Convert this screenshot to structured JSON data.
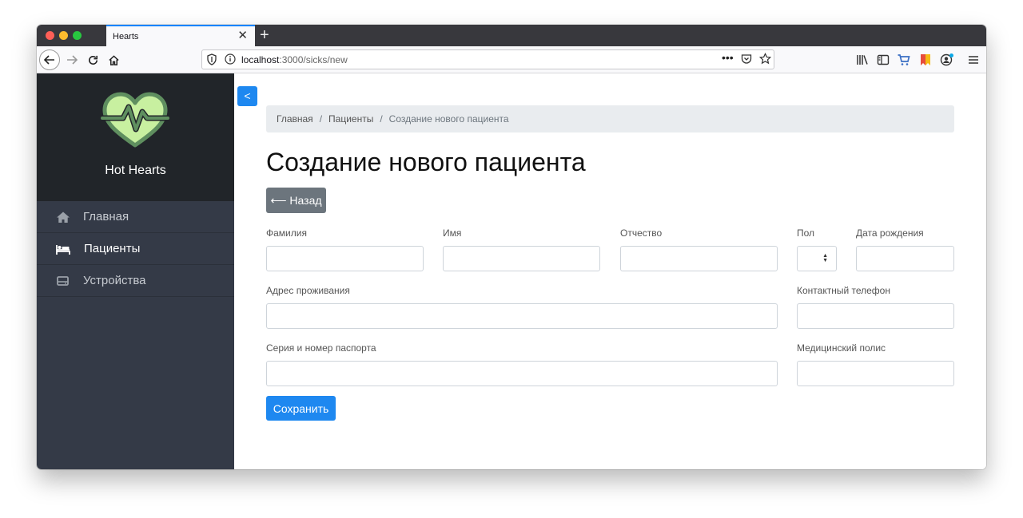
{
  "browser": {
    "tab_title": "Hearts",
    "new_tab_symbol": "+",
    "close_symbol": "✕",
    "url_host": "localhost",
    "url_path": ":3000/sicks/new",
    "url_more": "•••"
  },
  "sidebar": {
    "brand_name": "Hot Hearts",
    "items": [
      {
        "label": "Главная",
        "icon": "home-icon"
      },
      {
        "label": "Пациенты",
        "icon": "bed-icon"
      },
      {
        "label": "Устройства",
        "icon": "device-icon"
      }
    ]
  },
  "main": {
    "toggle_label": "<",
    "breadcrumb": [
      "Главная",
      "Пациенты",
      "Создание нового пациента"
    ],
    "breadcrumb_separator": "/",
    "page_title": "Создание нового пациента",
    "back_label": "⟵ Назад",
    "fields": {
      "last_name": {
        "label": "Фамилия",
        "value": ""
      },
      "first_name": {
        "label": "Имя",
        "value": ""
      },
      "patronymic": {
        "label": "Отчество",
        "value": ""
      },
      "gender": {
        "label": "Пол",
        "value": ""
      },
      "birth_date": {
        "label": "Дата рождения",
        "value": ""
      },
      "address": {
        "label": "Адрес проживания",
        "value": ""
      },
      "phone": {
        "label": "Контактный телефон",
        "value": ""
      },
      "passport": {
        "label": "Серия и номер паспорта",
        "value": ""
      },
      "insurance": {
        "label": "Медицинский полис",
        "value": ""
      }
    },
    "save_label": "Сохранить"
  },
  "colors": {
    "accent": "#1e88f0",
    "sidebar_bg": "#343a47",
    "brand_bg": "#212529",
    "logo_green": "#c8f0a0",
    "logo_outline": "#5f8f5f"
  }
}
